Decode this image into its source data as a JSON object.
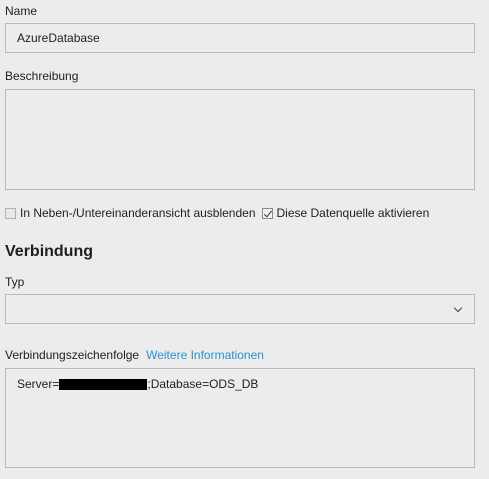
{
  "name": {
    "label": "Name",
    "value": "AzureDatabase"
  },
  "description": {
    "label": "Beschreibung",
    "value": ""
  },
  "options": {
    "hide_label": "In Neben-/Untereinanderansicht ausblenden",
    "hide_checked": false,
    "activate_label": "Diese Datenquelle aktivieren",
    "activate_checked": true
  },
  "connection": {
    "section_title": "Verbindung",
    "type_label": "Typ",
    "type_value": "",
    "string_label": "Verbindungszeichenfolge",
    "more_info_link": "Weitere Informationen",
    "string_prefix": "Server=",
    "string_suffix": ";Database=ODS_DB"
  },
  "colors": {
    "background": "#ececec",
    "border": "#b9b9b9",
    "link": "#2b8fd1",
    "redaction": "#000000"
  }
}
